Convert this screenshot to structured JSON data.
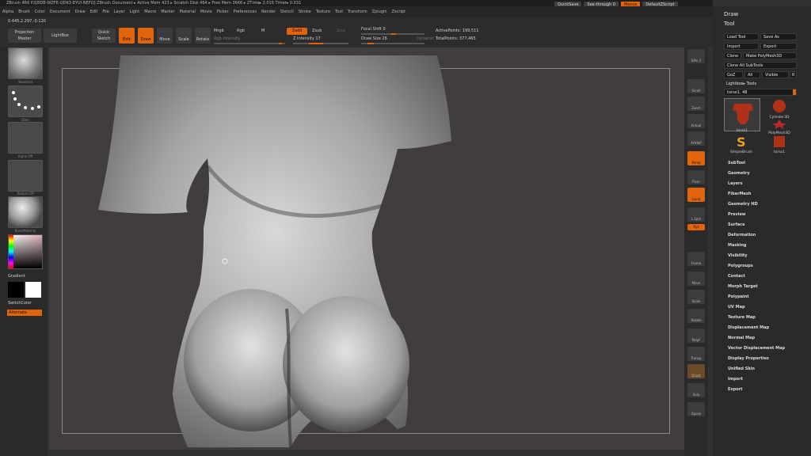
{
  "titlebar": {
    "text": "ZBrush 4R6 P2[BDB-WZFE-QDK3-EYUI-NEFQ]    ZBrush Document    ▸ Active Mem 423 ▸ Scratch Disk 464 ▸ Free Mem 3666 ▸ ZTime▸ 2.016 Timer▸ 0.031"
  },
  "menubar": {
    "items": [
      "Alpha",
      "Brush",
      "Color",
      "Document",
      "Draw",
      "Edit",
      "File",
      "Layer",
      "Light",
      "Macro",
      "Marker",
      "Material",
      "Movie",
      "Picker",
      "Preferences",
      "Render",
      "Stencil",
      "Stroke",
      "Texture",
      "Tool",
      "Transform",
      "Zplugin",
      "Zscript"
    ]
  },
  "quickbar": {
    "quicksave": "QuickSave",
    "seethrough": "See-through 0",
    "menus": "Menus",
    "defaultscript": "DefaultZScript"
  },
  "toolbar": {
    "coords": "0.445,2.297,-0.120",
    "projection_master": "Projection Master",
    "lightbox": "LightBox",
    "quick_sketch": "Quick Sketch",
    "edit": "Edit",
    "draw": "Draw",
    "move": "Move",
    "scale": "Scale",
    "rotate": "Rotate",
    "mrgb": "Mrgb",
    "rgb": "Rgb",
    "m": "M",
    "rgb_intensity": "Rgb Intensity",
    "zadd": "Zadd",
    "zsub": "Zsub",
    "zcut": "Zcut",
    "z_intensity": "Z Intensity 17",
    "focal_shift": "Focal Shift 0",
    "draw_size": "Draw Size 26",
    "dynamic": "Dynamic",
    "active_points": "ActivePoints: 199,511",
    "total_points": "TotalPoints: 377,465"
  },
  "leftshelf": {
    "brush": "Standard",
    "stroke": "Dots",
    "alpha": "Alpha Off",
    "texture": "Texture Off",
    "material": "BasicMaterial",
    "gradient": "Gradient",
    "switchcolor": "SwitchColor",
    "alternate": "Alternate"
  },
  "rightshelf": {
    "items": [
      "SPix 3",
      "Scroll",
      "Zoom",
      "Actual",
      "AAHalf",
      "Persp",
      "Floor",
      "Local",
      "L.Sym",
      "Xyz",
      "Frame",
      "Move",
      "Scale",
      "Rotate",
      "PolyF",
      "Transp",
      "Ghost",
      "Solo",
      "Xpose"
    ]
  },
  "panel": {
    "draw": "Draw",
    "tool": "Tool",
    "load_tool": "Load Tool",
    "save_as": "Save As",
    "import": "Import",
    "export": "Export",
    "clone": "Clone",
    "make_polymesh": "Make PolyMesh3D",
    "clone_all": "Clone All SubTools",
    "goz": "GoZ",
    "all": "All",
    "visible": "Visible",
    "r": "R",
    "lightbox_tools": "Lightbox▸ Tools",
    "torso": "torso1. 48",
    "thumbs": [
      "torso1",
      "Cylinder3D",
      "PolyMesh3D",
      "SimpleBrush",
      "torso1"
    ],
    "subpalettes": [
      "SubTool",
      "Geometry",
      "Layers",
      "FiberMesh",
      "Geometry HD",
      "Preview",
      "Surface",
      "Deformation",
      "Masking",
      "Visibility",
      "Polygroups",
      "Contact",
      "Morph Target",
      "Polypaint",
      "UV Map",
      "Texture Map",
      "Displacement Map",
      "Normal Map",
      "Vector Displacement Map",
      "Display Properties",
      "Unified Skin",
      "Import",
      "Export"
    ]
  },
  "colors": {
    "accent": "#e0640a",
    "canvas": "#413d3f"
  }
}
